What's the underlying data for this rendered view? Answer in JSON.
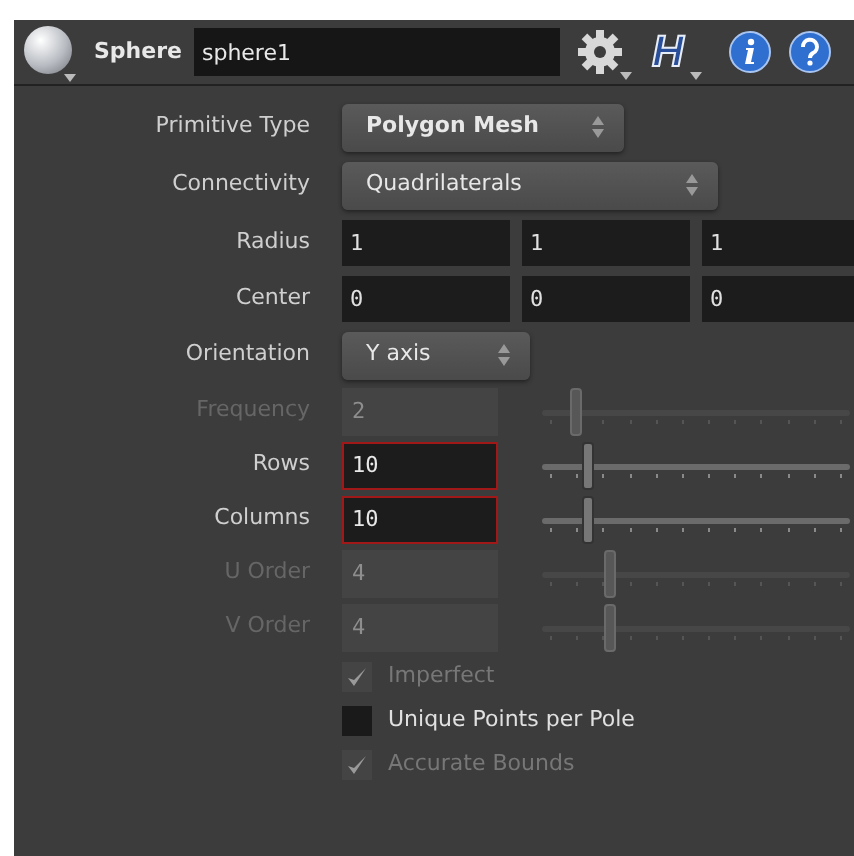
{
  "header": {
    "node_type": "Sphere",
    "node_name": "sphere1",
    "logo_text": "H"
  },
  "params": [
    {
      "kind": "menu",
      "label": "Primitive Type",
      "value": "Polygon Mesh",
      "bold": true
    },
    {
      "kind": "menu",
      "label": "Connectivity",
      "value": "Quadrilaterals",
      "bold": false
    },
    {
      "kind": "vector",
      "label": "Radius",
      "values": [
        "1",
        "1",
        "1"
      ]
    },
    {
      "kind": "vector",
      "label": "Center",
      "values": [
        "0",
        "0",
        "0"
      ]
    },
    {
      "kind": "menu",
      "label": "Orientation",
      "value": "Y axis",
      "bold": false
    },
    {
      "kind": "slider",
      "label": "Frequency",
      "value": "2",
      "level": 0.11,
      "disabled": true,
      "error": false
    },
    {
      "kind": "slider",
      "label": "Rows",
      "value": "10",
      "level": 0.15,
      "disabled": false,
      "error": true
    },
    {
      "kind": "slider",
      "label": "Columns",
      "value": "10",
      "level": 0.15,
      "disabled": false,
      "error": true
    },
    {
      "kind": "slider",
      "label": "U Order",
      "value": "4",
      "level": 0.22,
      "disabled": true,
      "error": false
    },
    {
      "kind": "slider",
      "label": "V Order",
      "value": "4",
      "level": 0.22,
      "disabled": true,
      "error": false
    },
    {
      "kind": "toggle",
      "label": "Imperfect",
      "checked": true,
      "disabled": true
    },
    {
      "kind": "toggle",
      "label": "Unique Points per Pole",
      "checked": false,
      "disabled": false
    },
    {
      "kind": "toggle",
      "label": "Accurate Bounds",
      "checked": true,
      "disabled": true
    }
  ]
}
